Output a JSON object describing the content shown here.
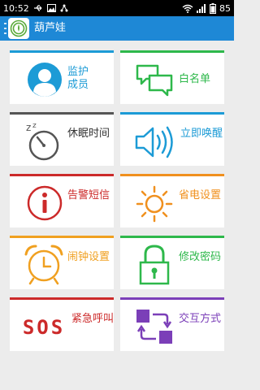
{
  "status_bar": {
    "time": "10:52",
    "battery": "85",
    "left_icons": [
      "usb-icon",
      "image-icon",
      "share-icon"
    ],
    "right_icons": [
      "wifi-icon",
      "signal-icon",
      "battery-icon"
    ]
  },
  "app_bar": {
    "title": "葫芦娃",
    "color": "#1e88d6"
  },
  "tiles": [
    {
      "id": "monitor-member",
      "label": "监护成员",
      "icon": "person-avatar-icon",
      "color": "#1c9bd6"
    },
    {
      "id": "whitelist",
      "label": "白名单",
      "icon": "chat-bubbles-icon",
      "color": "#2eb84b"
    },
    {
      "id": "sleep-time",
      "label": "休眠时间",
      "icon": "sleep-clock-icon",
      "color": "#555555"
    },
    {
      "id": "wake-now",
      "label": "立即唤醒",
      "icon": "speaker-icon",
      "color": "#1c9bd6"
    },
    {
      "id": "alarm-sms",
      "label": "告警短信",
      "icon": "info-circle-icon",
      "color": "#cc2a2a"
    },
    {
      "id": "power-save",
      "label": "省电设置",
      "icon": "sun-icon",
      "color": "#f0901e"
    },
    {
      "id": "alarm-clock",
      "label": "闹钟设置",
      "icon": "alarm-clock-icon",
      "color": "#f0a020"
    },
    {
      "id": "change-password",
      "label": "修改密码",
      "icon": "lock-icon",
      "color": "#2eb84b"
    },
    {
      "id": "sos",
      "label": "紧急呼叫",
      "icon": "sos-icon",
      "color": "#cc2a2a"
    },
    {
      "id": "interaction",
      "label": "交互方式",
      "icon": "swap-squares-icon",
      "color": "#7b3fb8"
    }
  ]
}
